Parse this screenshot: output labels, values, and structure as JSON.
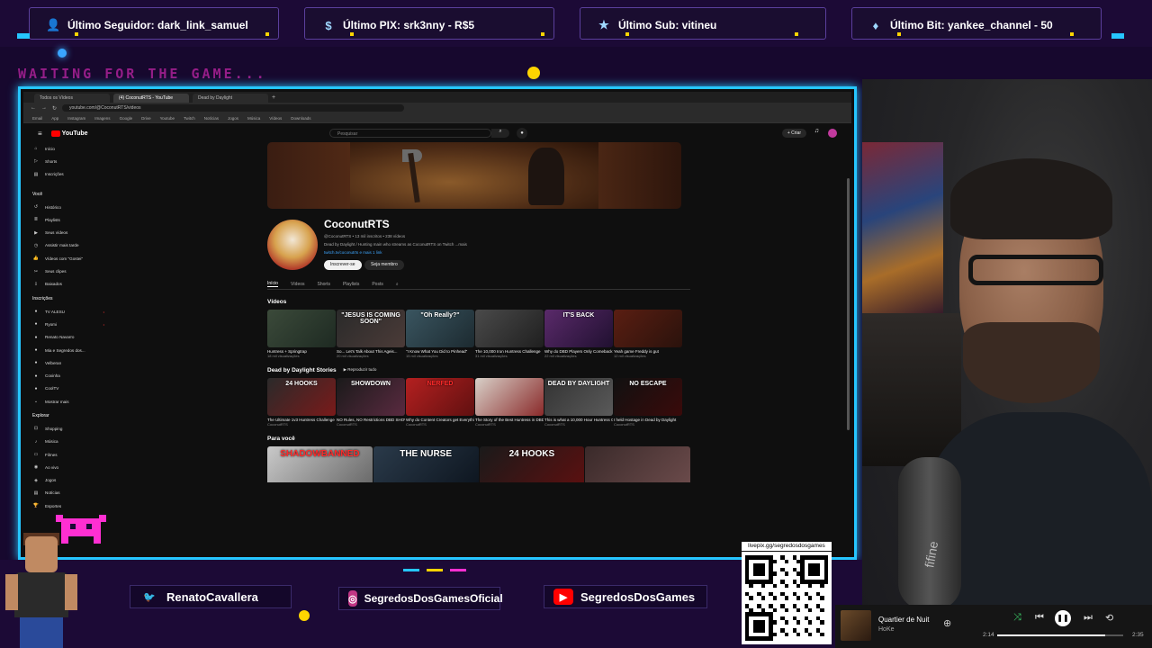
{
  "alerts": [
    {
      "icon": "user-icon",
      "text": "Último Seguidor: dark_link_samuel"
    },
    {
      "icon": "dollar-icon",
      "text": "Último PIX: srk3nny - R$5"
    },
    {
      "icon": "star-icon",
      "text": "Último Sub: vitineu"
    },
    {
      "icon": "diamond-icon",
      "text": "Último Bit: yankee_channel - 50"
    }
  ],
  "overlay": {
    "waiting": "WAITING FOR THE GAME..."
  },
  "browser": {
    "tabs": [
      "Todos os Vídeos",
      "(4) CoconutRTS - YouTube",
      "Dead by Daylight"
    ],
    "url": "youtube.com/@CoconutRTS/videos",
    "bookmarks": [
      "Email",
      "App",
      "Instagram",
      "Imagens",
      "Google",
      "Drive",
      "Youtube",
      "Twitch",
      "Notícias",
      "Jogos",
      "Música",
      "Vídeos",
      "Downloads"
    ]
  },
  "youtube": {
    "logo": "YouTube",
    "search_placeholder": "Pesquisar",
    "create": "+ Criar",
    "sidebar": {
      "main": [
        "Início",
        "Shorts",
        "Inscrições"
      ],
      "you_header": "Você",
      "you": [
        "Histórico",
        "Playlists",
        "Seus vídeos",
        "Assistir mais tarde",
        "Vídeos com \"Gostei\"",
        "Seus clipes",
        "Baixados"
      ],
      "subs_header": "Inscrições",
      "subs": [
        "TV ALESU",
        "Ryomi",
        "Renato Navarro",
        "Mia e Segredos dos...",
        "Velberan",
        "Coxinha",
        "CoolTV",
        "Mostrar mais"
      ],
      "explore_header": "Explorar",
      "explore": [
        "Shopping",
        "Música",
        "Filmes",
        "Ao vivo",
        "Jogos",
        "Notícias",
        "Esportes"
      ]
    },
    "channel": {
      "name": "CoconutRTS",
      "meta": "@CoconutRTS • 13 mil inscritos • 238 vídeos",
      "desc": "Dead by Daylight / Hunting main who streams as CoconutRTS on Twitch ...mais",
      "link": "twitch.tv/coconutrts e mais 1 link",
      "subscribe": "Inscrever-se",
      "join": "Seja membro",
      "tabs": [
        "Início",
        "Vídeos",
        "Shorts",
        "Playlists",
        "Posts"
      ]
    },
    "section1": {
      "title": "Vídeos",
      "cards": [
        {
          "thumb": "",
          "title": "Huntress + Springtrap",
          "meta": "18 mil visualizações"
        },
        {
          "thumb": "\"JESUS IS COMING SOON\"",
          "title": "So... Let's Talk About This Ageis...",
          "meta": "20 mil visualizações"
        },
        {
          "thumb": "\"Oh Really?\"",
          "title": "\"I Know What You Did to Pinhead\"",
          "meta": "15 mil visualizações"
        },
        {
          "thumb": "",
          "title": "The 10,000 Iron Huntress Challenge",
          "meta": "31 mil visualizações"
        },
        {
          "thumb": "IT'S BACK",
          "title": "Why do DBD Players Only Comeback During Updates?",
          "meta": "22 mil visualizações"
        },
        {
          "thumb": "",
          "title": "Yeah game Freddy is gut",
          "meta": "12 mil visualizações"
        }
      ]
    },
    "section2": {
      "title": "Dead by Daylight Stories",
      "play_all": "Reproduzir tudo",
      "cards": [
        {
          "thumb": "24 HOOKS",
          "title": "The Ultimate 1v3 Huntress Challenge",
          "meta": "CoconutRTS"
        },
        {
          "thumb": "SHOWDOWN",
          "title": "NO Rules, NO Restrictions DBD SHOWDOWN",
          "meta": "CoconutRTS"
        },
        {
          "thumb": "NERFED",
          "title": "Why do Content Creators get Everything Nerfed?",
          "meta": "CoconutRTS"
        },
        {
          "thumb": "",
          "title": "The Story of the Best Huntress in DBD",
          "meta": "CoconutRTS"
        },
        {
          "thumb": "DEAD BY DAYLIGHT",
          "title": "This is what a 10,000 Hour Huntress Obsession Looks...",
          "meta": "CoconutRTS"
        },
        {
          "thumb": "NO ESCAPE",
          "title": "I held Hostage in Dead by Daylight",
          "meta": "CoconutRTS"
        }
      ]
    },
    "section3": {
      "title": "Para você",
      "thumbs": [
        "SHADOWBANNED",
        "THE NURSE",
        "24 HOOKS",
        ""
      ]
    }
  },
  "socials": [
    {
      "icon": "twitter-icon",
      "text": "RenatoCavallera",
      "color": "#1da1f2"
    },
    {
      "icon": "instagram-icon",
      "text": "SegredosDosGamesOficial",
      "color": "#c13584"
    },
    {
      "icon": "youtube-icon",
      "text": "SegredosDosGames",
      "color": "#ff0000"
    }
  ],
  "qr": {
    "label": "livepix.gg/segredosdosgames"
  },
  "player": {
    "title": "Quartier de Nuit",
    "artist": "HoKe",
    "elapsed": "2:14",
    "total": "2:35",
    "progress": 0.86
  },
  "webcam": {
    "mic_brand": "fifine"
  },
  "colors": {
    "frame": "#26c6ff",
    "overlay_bg": "#1c0a36",
    "accent_pink": "#ff2fd2",
    "accent_yellow": "#ffd400"
  }
}
